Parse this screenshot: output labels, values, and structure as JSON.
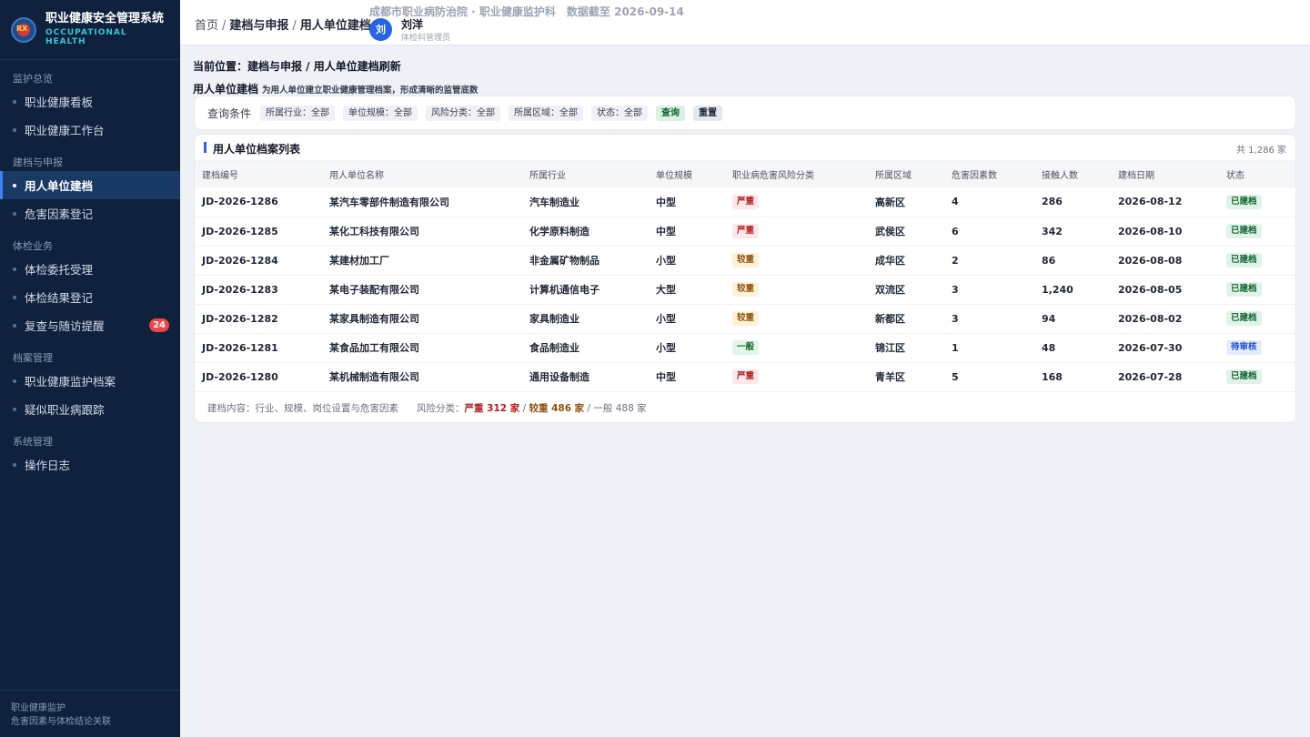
{
  "brand": {
    "title": "职业健康安全管理系统",
    "subtitle_line1": "OCCUPATIONAL",
    "subtitle_line2": "HEALTH"
  },
  "sidebar": {
    "groups": [
      {
        "label": "监护总览",
        "items": [
          {
            "label": "职业健康看板"
          },
          {
            "label": "职业健康工作台"
          }
        ]
      },
      {
        "label": "建档与申报",
        "items": [
          {
            "label": "用人单位建档",
            "active": true
          },
          {
            "label": "危害因素登记"
          }
        ]
      },
      {
        "label": "体检业务",
        "items": [
          {
            "label": "体检委托受理"
          },
          {
            "label": "体检结果登记"
          },
          {
            "label": "复查与随访提醒",
            "badge": "24"
          }
        ]
      },
      {
        "label": "档案管理",
        "items": [
          {
            "label": "职业健康监护档案"
          },
          {
            "label": "疑似职业病跟踪"
          }
        ]
      },
      {
        "label": "系统管理",
        "items": [
          {
            "label": "操作日志"
          }
        ]
      }
    ],
    "footer_line1": "职业健康监护",
    "footer_line2": "危害因素与体检结论关联"
  },
  "topbar": {
    "breadcrumb": [
      "首页",
      "建档与申报",
      "用人单位建档"
    ],
    "org": "成都市职业病防治院 · 职业健康监护科",
    "data_date": "数据截至 2026-09-14",
    "user_avatar": "刘",
    "user_name": "刘洋",
    "user_role": "体检科管理员"
  },
  "page": {
    "position": "当前位置：建档与申报 / 用人单位建档刷新",
    "title": "用人单位建档",
    "description": "为用人单位建立职业健康管理档案，形成清晰的监管底数"
  },
  "filter": {
    "label": "查询条件",
    "chips": [
      "所属行业：全部",
      "单位规模：全部",
      "风险分类：全部",
      "所属区域：全部",
      "状态：全部"
    ],
    "query_label": "查询",
    "reset_label": "重置"
  },
  "table": {
    "title": "用人单位档案列表",
    "count": "共 1,286 家",
    "columns": [
      "建档编号",
      "用人单位名称",
      "所属行业",
      "单位规模",
      "职业病危害风险分类",
      "所属区域",
      "危害因素数",
      "接触人数",
      "建档日期",
      "状态"
    ],
    "rows": [
      {
        "id": "JD-2026-1286",
        "name": "某汽车零部件制造有限公司",
        "industry": "汽车制造业",
        "scale": "中型",
        "risk": "严重",
        "risk_level": "sev",
        "area": "高新区",
        "hazards": "4",
        "exposed": "286",
        "date": "2026-08-12",
        "status": "已建档",
        "status_type": "done"
      },
      {
        "id": "JD-2026-1285",
        "name": "某化工科技有限公司",
        "industry": "化学原料制造",
        "scale": "中型",
        "risk": "严重",
        "risk_level": "sev",
        "area": "武侯区",
        "hazards": "6",
        "exposed": "342",
        "date": "2026-08-10",
        "status": "已建档",
        "status_type": "done"
      },
      {
        "id": "JD-2026-1284",
        "name": "某建材加工厂",
        "industry": "非金属矿物制品",
        "scale": "小型",
        "risk": "较重",
        "risk_level": "mid",
        "area": "成华区",
        "hazards": "2",
        "exposed": "86",
        "date": "2026-08-08",
        "status": "已建档",
        "status_type": "done"
      },
      {
        "id": "JD-2026-1283",
        "name": "某电子装配有限公司",
        "industry": "计算机通信电子",
        "scale": "大型",
        "risk": "较重",
        "risk_level": "mid",
        "area": "双流区",
        "hazards": "3",
        "exposed": "1,240",
        "date": "2026-08-05",
        "status": "已建档",
        "status_type": "done"
      },
      {
        "id": "JD-2026-1282",
        "name": "某家具制造有限公司",
        "industry": "家具制造业",
        "scale": "小型",
        "risk": "较重",
        "risk_level": "mid",
        "area": "新都区",
        "hazards": "3",
        "exposed": "94",
        "date": "2026-08-02",
        "status": "已建档",
        "status_type": "done"
      },
      {
        "id": "JD-2026-1281",
        "name": "某食品加工有限公司",
        "industry": "食品制造业",
        "scale": "小型",
        "risk": "一般",
        "risk_level": "low",
        "area": "锦江区",
        "hazards": "1",
        "exposed": "48",
        "date": "2026-07-30",
        "status": "待审核",
        "status_type": "wait"
      },
      {
        "id": "JD-2026-1280",
        "name": "某机械制造有限公司",
        "industry": "通用设备制造",
        "scale": "中型",
        "risk": "严重",
        "risk_level": "sev",
        "area": "青羊区",
        "hazards": "5",
        "exposed": "168",
        "date": "2026-07-28",
        "status": "已建档",
        "status_type": "done"
      }
    ],
    "footer_content": "建档内容：行业、规模、岗位设置与危害因素",
    "footer_risk_label": "风险分类：",
    "footer_severe": "严重 312 家",
    "footer_medium": "较重 486 家",
    "footer_general": "一般 488 家"
  },
  "colors": {
    "sidebar_bg": "#0f213c",
    "accent": "#2563eb",
    "severe": "#b91c1c",
    "medium": "#92500e",
    "general": "#166534"
  }
}
